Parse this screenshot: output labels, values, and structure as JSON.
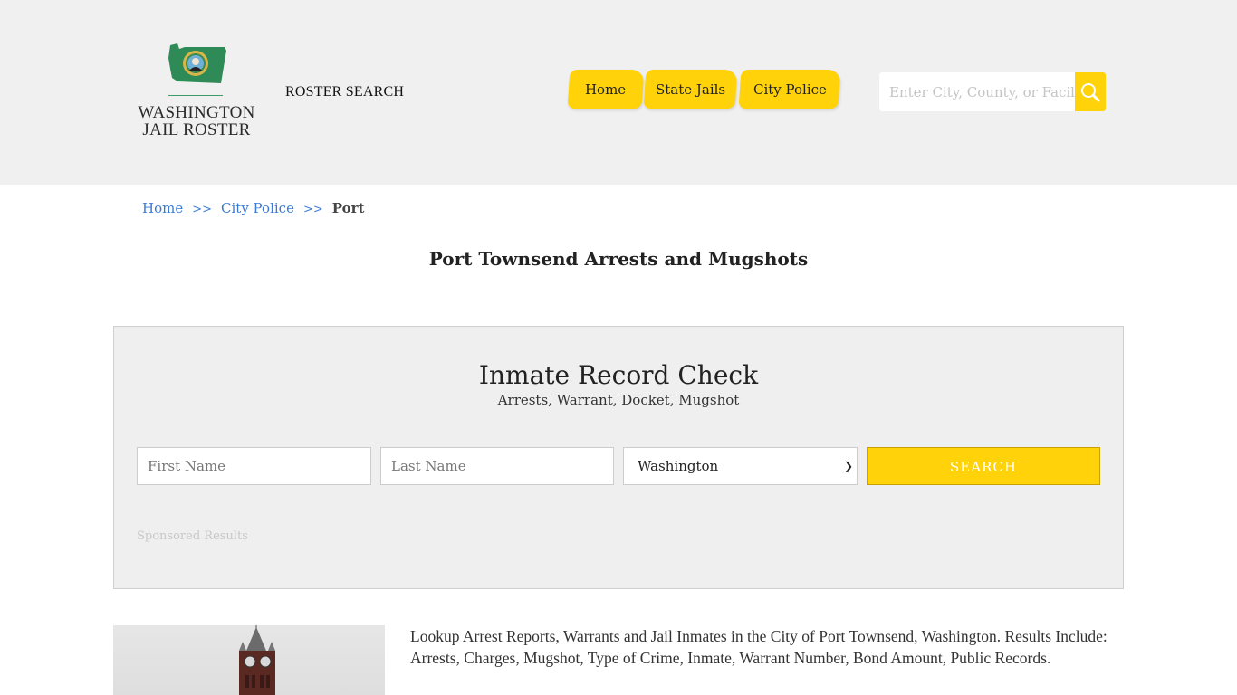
{
  "header": {
    "logo": {
      "line1": "WASHINGTON",
      "line2": "JAIL ROSTER",
      "icon": "washington-state-seal-map-icon",
      "map_color": "#2e8b57"
    },
    "roster_search_label": "ROSTER SEARCH",
    "nav": [
      {
        "label": "Home"
      },
      {
        "label": "State Jails"
      },
      {
        "label": "City Police"
      }
    ],
    "search": {
      "placeholder": "Enter City, County, or Facility",
      "value": "",
      "button_icon": "search-icon"
    },
    "accent_color": "#ffd20a"
  },
  "breadcrumb": {
    "items": [
      {
        "label": "Home",
        "link": true
      },
      {
        "label": "City Police",
        "link": true
      },
      {
        "label": "Port",
        "link": false
      }
    ],
    "separator": ">>"
  },
  "page_title": "Port Townsend Arrests and Mugshots",
  "record_check": {
    "title": "Inmate Record Check",
    "subtitle": "Arrests, Warrant, Docket, Mugshot",
    "first_name": {
      "placeholder": "First Name",
      "value": ""
    },
    "last_name": {
      "placeholder": "Last Name",
      "value": ""
    },
    "state": {
      "selected": "Washington"
    },
    "submit_label": "SEARCH",
    "sponsored_label": "Sponsored Results"
  },
  "content": {
    "image_alt": "Port Townsend clock tower",
    "description": "Lookup Arrest Reports, Warrants and Jail Inmates in the City of Port Townsend, Washington. Results Include: Arrests, Charges, Mugshot, Type of Crime, Inmate, Warrant Number, Bond Amount, Public Records."
  }
}
